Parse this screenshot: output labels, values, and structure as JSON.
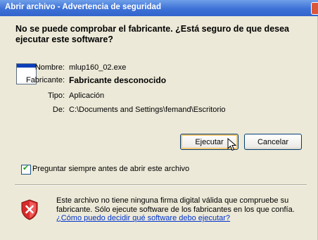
{
  "window": {
    "title": "Abrir archivo - Advertencia de seguridad"
  },
  "question": "No se puede comprobar el fabricante. ¿Está seguro de que desea ejecutar este software?",
  "file_icon": "application-window-icon",
  "fields": [
    {
      "label": "Nombre:",
      "value": "mlup160_02.exe",
      "bold": false
    },
    {
      "label": "Fabricante:",
      "value": "Fabricante desconocido",
      "bold": true
    },
    {
      "label": "Tipo:",
      "value": "Aplicación",
      "bold": false
    },
    {
      "label": "De:",
      "value": "C:\\Documents and Settings\\femand\\Escritorio",
      "bold": false
    }
  ],
  "buttons": {
    "run": "Ejecutar",
    "cancel": "Cancelar"
  },
  "checkbox": {
    "label": "Preguntar siempre antes de abrir este archivo",
    "checked": true
  },
  "warning": {
    "icon": "shield-warning-icon",
    "text": "Este archivo no tiene ninguna firma digital válida que compruebe su fabricante. Sólo ejecute software de los fabricantes en los que confía.",
    "link": "¿Cómo puedo decidir qué software debo ejecutar?"
  },
  "colors": {
    "titlebar": "#3d71d6",
    "dialog_bg": "#ece9d8",
    "link": "#0033cc"
  }
}
